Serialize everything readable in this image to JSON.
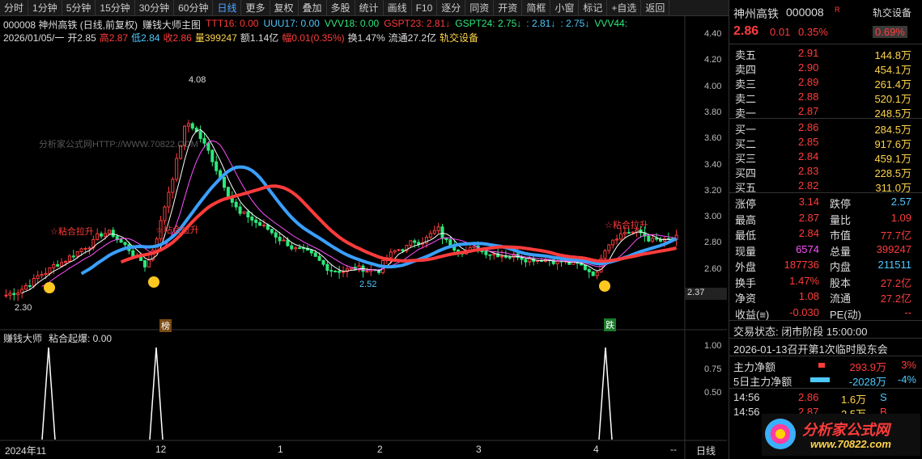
{
  "toolbar": {
    "items": [
      "分时",
      "1分钟",
      "5分钟",
      "15分钟",
      "30分钟",
      "60分钟",
      "日线",
      "更多",
      "复权",
      "叠加",
      "多股",
      "统计",
      "画线",
      "F10",
      "逐分",
      "同资",
      "开资",
      "简框",
      "小窗",
      "标记",
      "+自选",
      "返回"
    ]
  },
  "header": {
    "code_name": "000008 神州高铁 (日线,前复权)",
    "formula": "赚钱大师主图",
    "ttt": "TTT16: 0.00",
    "uuu": "UUU17: 0.00",
    "vvv18": "VVV18: 0.00",
    "gspt23": "GSPT23: 2.81↓",
    "gspt24": "GSPT24: 2.75↓",
    "v281": ": 2.81↓",
    "v275": ": 2.75↓",
    "vvv44": "VVV44:"
  },
  "ohlc": {
    "date": "2026/01/05/一",
    "open": "开2.85",
    "high": "高2.87",
    "low": "低2.84",
    "close": "收2.86",
    "volume": "量399247",
    "amount": "额1.14亿",
    "change": "幅0.01(0.35%)",
    "turnover": "换1.47%",
    "float": "流通27.2亿",
    "industry": "轨交设备"
  },
  "y_axis": [
    "4.40",
    "4.20",
    "4.00",
    "3.80",
    "3.60",
    "3.40",
    "3.20",
    "3.00",
    "2.80",
    "2.60"
  ],
  "price_marker": "2.37",
  "annot": {
    "high": "4.08",
    "low": "2.30",
    "low2": "2.52",
    "sig1": "☆粘合拉升",
    "sig2": "☆粘合拉升",
    "sig3": "☆粘合拉升",
    "bang": "榜",
    "die": "跌"
  },
  "watermark_url": "分析家公式网HTTP://WWW.70822.COM",
  "sub": {
    "title": "赚钱大师",
    "indicator": "粘合起爆: 0.00",
    "y": [
      "1.00",
      "0.75",
      "0.50"
    ]
  },
  "x_axis": [
    "2024年11",
    "12",
    "1",
    "2",
    "3",
    "4",
    "--"
  ],
  "x_end": "日线",
  "quote": {
    "name": "神州高铁",
    "code": "000008",
    "flag": "R",
    "price": "2.86",
    "chg": "0.01",
    "pct": "0.35%",
    "sector": "轨交设备",
    "sector_pct": "0.69%"
  },
  "asks": [
    {
      "l": "卖五",
      "p": "2.91",
      "v": "144.8万",
      "extra": "¥"
    },
    {
      "l": "卖四",
      "p": "2.90",
      "v": "454.1万"
    },
    {
      "l": "卖三",
      "p": "2.89",
      "v": "261.4万"
    },
    {
      "l": "卖二",
      "p": "2.88",
      "v": "520.1万"
    },
    {
      "l": "卖一",
      "p": "2.87",
      "v": "248.5万"
    }
  ],
  "bids": [
    {
      "l": "买一",
      "p": "2.86",
      "v": "284.5万"
    },
    {
      "l": "买二",
      "p": "2.85",
      "v": "917.6万"
    },
    {
      "l": "买三",
      "p": "2.84",
      "v": "459.1万"
    },
    {
      "l": "买四",
      "p": "2.83",
      "v": "228.5万"
    },
    {
      "l": "买五",
      "p": "2.82",
      "v": "311.0万"
    }
  ],
  "stats": [
    [
      "涨停",
      "3.14",
      "跌停",
      "2.57"
    ],
    [
      "最高",
      "2.87",
      "量比",
      "1.09"
    ],
    [
      "最低",
      "2.84",
      "市值",
      "77.7亿"
    ],
    [
      "现量",
      "6574",
      "总量",
      "399247"
    ],
    [
      "外盘",
      "187736",
      "内盘",
      "211511"
    ],
    [
      "换手",
      "1.47%",
      "股本",
      "27.2亿"
    ],
    [
      "净资",
      "1.08",
      "流通",
      "27.2亿"
    ],
    [
      "收益(≡)",
      "-0.030",
      "PE(动)",
      "--"
    ]
  ],
  "status": {
    "trade": "交易状态: 闭市阶段 15:00:00",
    "meeting": "2026-01-13召开第1次临时股东会"
  },
  "flow": [
    {
      "label": "主力净额",
      "val": "293.9万",
      "pct": "3%"
    },
    {
      "label": "5日主力净额",
      "val": "-2028万",
      "pct": "-4%"
    }
  ],
  "ticks": [
    {
      "t": "14:56",
      "p": "2.86",
      "v": "1.6万",
      "d": "S"
    },
    {
      "t": "14:56",
      "p": "2.87",
      "v": "2.5万",
      "d": "B"
    }
  ],
  "logo": {
    "title": "分析家公式网",
    "url": "www.70822.com"
  },
  "colors": {
    "up": "#ff3c3c",
    "down": "#2ee87a",
    "ma1": "#ffffff",
    "ma2": "#ffd44a",
    "ma3": "#ff50ff",
    "ma4": "#3aa0ff"
  }
}
